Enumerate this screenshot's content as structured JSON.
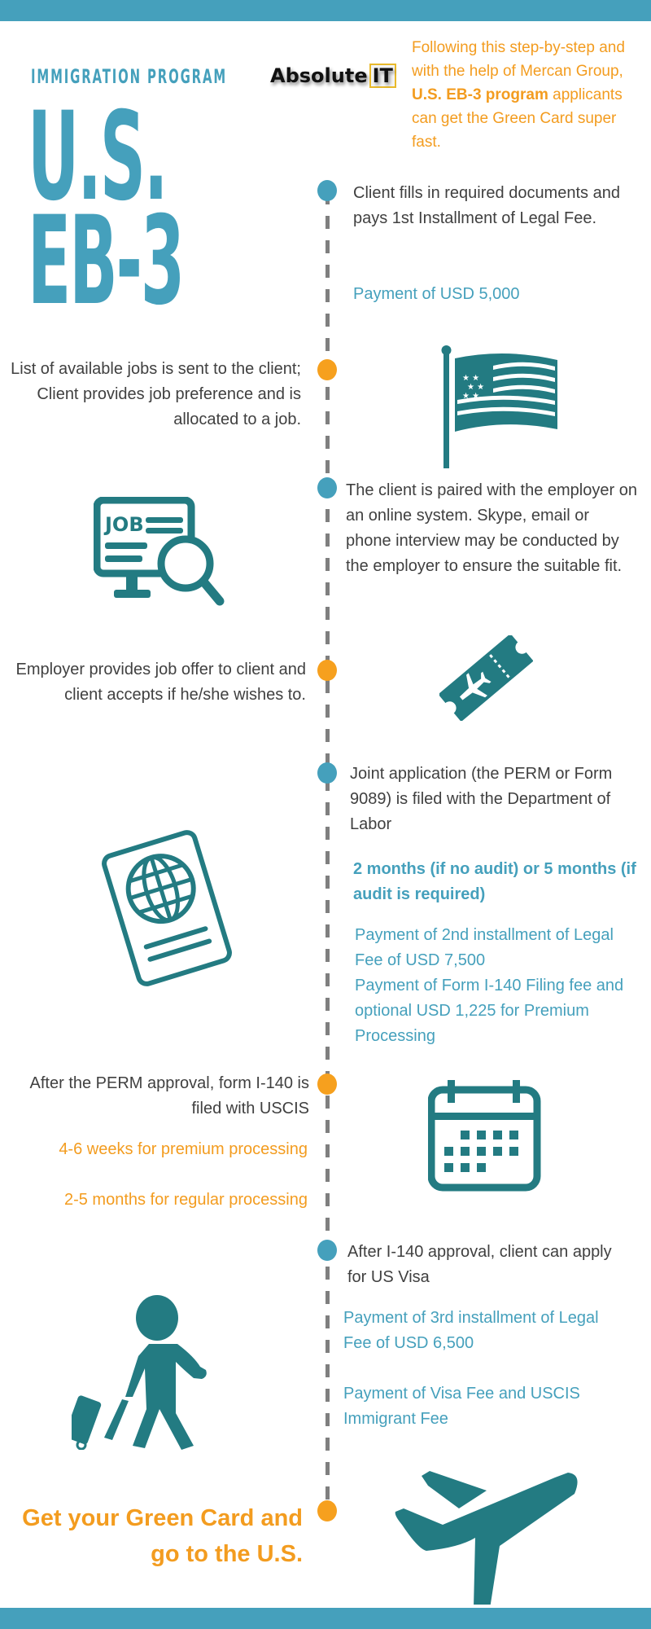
{
  "header": {
    "kicker": "IMMIGRATION PROGRAM",
    "logo": {
      "word": "Absolute",
      "badge": "IT"
    },
    "title_line1": "U.S.",
    "title_line2": "EB-3",
    "intro": {
      "part1": "Following this step-by-step and with the help of Mercan Group, ",
      "bold": "U.S. EB-3 program",
      "part2": " applicants can get the Green Card super fast."
    }
  },
  "colors": {
    "primary": "#45a0bc",
    "accent": "#f6a01e",
    "icon": "#237b82",
    "text": "#404040",
    "timeline": "#7f7f7f"
  },
  "steps": [
    {
      "dot": "blue",
      "text": "Client fills in required documents and pays 1st Installment of Legal Fee.",
      "note": "Payment of USD 5,000"
    },
    {
      "dot": "orange",
      "text": "List of available jobs is sent to the client; Client provides job preference and is allocated to a job.",
      "icon": "us-flag-icon"
    },
    {
      "dot": "blue",
      "text": "The client is paired with the employer on an online system. Skype, email or phone interview may be conducted by the employer to ensure the suitable fit.",
      "icon": "job-search-monitor-icon"
    },
    {
      "dot": "orange",
      "text": "Employer provides job offer to client and client accepts if he/she wishes to.",
      "icon": "plane-ticket-icon"
    },
    {
      "dot": "blue",
      "text": "Joint application (the PERM or Form 9089) is filed with the Department of Labor",
      "duration": "2 months (if no audit) or 5 months (if audit is required)",
      "notes": [
        "Payment of 2nd installment of Legal Fee of USD 7,500",
        "Payment of Form I-140 Filing fee and optional USD 1,225 for Premium Processing"
      ],
      "icon": "passport-icon"
    },
    {
      "dot": "orange",
      "text": "After the PERM approval, form I-140 is filed with USCIS",
      "durations": [
        "4-6 weeks for premium processing",
        "2-5 months for regular processing"
      ],
      "icon": "calendar-icon"
    },
    {
      "dot": "blue",
      "text": "After I-140 approval, client can apply for US Visa",
      "notes": [
        "Payment of 3rd installment of Legal Fee of USD 6,500",
        "Payment of Visa Fee and USCIS Immigrant Fee"
      ],
      "icon": "traveler-with-luggage-icon"
    },
    {
      "dot": "orange",
      "text": "Get your Green Card and go to the U.S.",
      "icon": "airplane-icon"
    }
  ]
}
